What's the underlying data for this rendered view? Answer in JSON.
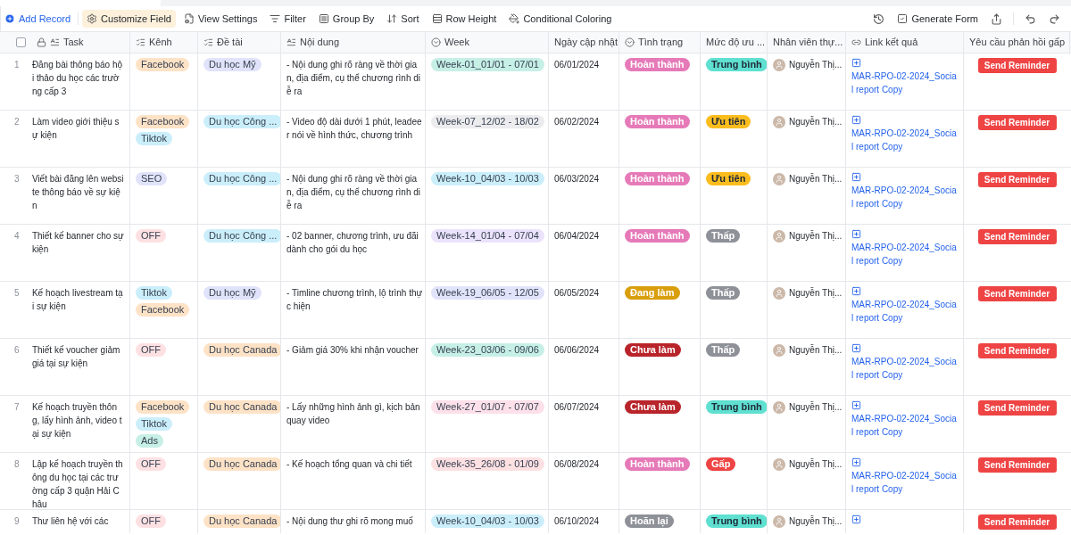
{
  "toolbar": {
    "add_record": "Add Record",
    "tools": [
      {
        "label": "Customize Field",
        "selected": true
      },
      {
        "label": "View Settings",
        "selected": false
      },
      {
        "label": "Filter",
        "selected": false
      },
      {
        "label": "Group By",
        "selected": false
      },
      {
        "label": "Sort",
        "selected": false
      },
      {
        "label": "Row Height",
        "selected": false
      },
      {
        "label": "Conditional Coloring",
        "selected": false
      }
    ],
    "generate_form": "Generate Form"
  },
  "table": {
    "select_all": {
      "checked": false
    },
    "columns": [
      "Task",
      "Kênh",
      "Đề tài",
      "Nội dung",
      "Week",
      "Ngày cập nhật",
      "Tình trạng",
      "Mức độ ưu ...",
      "Nhân viên thự...",
      "Link kết quả",
      "Yêu cầu phản hồi gấp"
    ],
    "rows": [
      {
        "number": "1",
        "task": "Đăng bài thông báo hội thảo du học các trường cấp 3",
        "channels": [
          {
            "label": "Facebook",
            "color": "#fde2c6"
          }
        ],
        "topics": [
          {
            "label": "Du học Mỹ",
            "color": "#e1e3fa"
          }
        ],
        "notes": "- Nội dung ghi rõ ràng về thời gian, địa điểm, cụ thể chương rình diễ ra",
        "week": {
          "label": "Week-01_01/01 - 07/01",
          "color": "#c6efe6"
        },
        "updated": "06/01/2024",
        "status": {
          "label": "Hoàn thành",
          "color": "#e67ab8"
        },
        "priority": {
          "label": "Trung bình",
          "color": "#5fe0d1"
        },
        "assignee": "Nguyễn Thị...",
        "link": "MAR-RPO-02-2024_Social report Copy",
        "action": "Send Reminder"
      },
      {
        "number": "2",
        "task": "Làm video giới thiệu sự kiện",
        "channels": [
          {
            "label": "Facebook",
            "color": "#fde2c6"
          },
          {
            "label": "Tiktok",
            "color": "#cbeefb"
          }
        ],
        "topics": [
          {
            "label": "Du học Công ...",
            "color": "#cbeefb"
          }
        ],
        "notes": "- Video độ dài dưới 1 phút, leadeer nói về hình thức, chương trình",
        "week": {
          "label": "Week-07_12/02 - 18/02",
          "color": "#ececee"
        },
        "updated": "06/02/2024",
        "status": {
          "label": "Hoàn thành",
          "color": "#e67ab8"
        },
        "priority": {
          "label": "Ưu tiên",
          "color": "#fbbd1e"
        },
        "assignee": "Nguyễn Thị...",
        "link": "MAR-RPO-02-2024_Social report Copy",
        "action": "Send Reminder"
      },
      {
        "number": "3",
        "task": "Viết bài đăng lên website thông báo về sự kiện",
        "channels": [
          {
            "label": "SEO",
            "color": "#e1e3fa"
          }
        ],
        "topics": [
          {
            "label": "Du học Công ...",
            "color": "#cbeefb"
          }
        ],
        "notes": "- Nội dung ghi rõ ràng về thời gian, địa điểm, cụ thể chương rình diễ ra",
        "week": {
          "label": "Week-10_04/03 - 10/03",
          "color": "#cbeefb"
        },
        "updated": "06/03/2024",
        "status": {
          "label": "Hoàn thành",
          "color": "#e67ab8"
        },
        "priority": {
          "label": "Ưu tiên",
          "color": "#fbbd1e"
        },
        "assignee": "Nguyễn Thị...",
        "link": "MAR-RPO-02-2024_Social report Copy",
        "action": "Send Reminder"
      },
      {
        "number": "4",
        "task": "Thiết kế banner cho sự kiện",
        "channels": [
          {
            "label": "OFF",
            "color": "#fde0e2"
          }
        ],
        "topics": [
          {
            "label": "Du học Công ...",
            "color": "#cbeefb"
          }
        ],
        "notes": "- 02 banner, chương trình, ưu đãi dành cho gói du học",
        "week": {
          "label": "Week-14_01/04 - 07/04",
          "color": "#ebe3fb"
        },
        "updated": "06/04/2024",
        "status": {
          "label": "Hoàn thành",
          "color": "#e67ab8"
        },
        "priority": {
          "label": "Thấp",
          "color": "#8f9199"
        },
        "assignee": "Nguyễn Thị...",
        "link": "MAR-RPO-02-2024_Social report Copy",
        "action": "Send Reminder"
      },
      {
        "number": "5",
        "task": "Kế hoạch livestream tại sự kiện",
        "channels": [
          {
            "label": "Tiktok",
            "color": "#cbeefb"
          },
          {
            "label": "Facebook",
            "color": "#fde2c6"
          }
        ],
        "topics": [
          {
            "label": "Du học Mỹ",
            "color": "#e1e3fa"
          }
        ],
        "notes": "- Timline chương trình, lộ trình thực hiện",
        "week": {
          "label": "Week-19_06/05 - 12/05",
          "color": "#e1e3fa"
        },
        "updated": "06/05/2024",
        "status": {
          "label": "Đang làm",
          "color": "#d99e0c"
        },
        "priority": {
          "label": "Thấp",
          "color": "#8f9199"
        },
        "assignee": "Nguyễn Thị...",
        "link": "MAR-RPO-02-2024_Social report Copy",
        "action": "Send Reminder"
      },
      {
        "number": "6",
        "task": "Thiết kế voucher giảm giá tại sự kiện",
        "channels": [
          {
            "label": "OFF",
            "color": "#fde0e2"
          }
        ],
        "topics": [
          {
            "label": "Du học Canada",
            "color": "#fde2c6"
          }
        ],
        "notes": "- Giảm giá 30% khi nhận voucher",
        "week": {
          "label": "Week-23_03/06 - 09/06",
          "color": "#c6efe6"
        },
        "updated": "06/06/2024",
        "status": {
          "label": "Chưa làm",
          "color": "#b8242a"
        },
        "priority": {
          "label": "Thấp",
          "color": "#8f9199"
        },
        "assignee": "Nguyễn Thị...",
        "link": "MAR-RPO-02-2024_Social report Copy",
        "action": "Send Reminder"
      },
      {
        "number": "7",
        "task": "Kế hoạch truyền thông, lấy hình ảnh, video tại sự kiện",
        "channels": [
          {
            "label": "Facebook",
            "color": "#fde2c6"
          },
          {
            "label": "Tiktok",
            "color": "#cbeefb"
          },
          {
            "label": "Ads",
            "color": "#c6efe6"
          }
        ],
        "topics": [
          {
            "label": "Du học Canada",
            "color": "#fde2c6"
          }
        ],
        "notes": "- Lấy những hình ảnh gì, kịch bản quay video",
        "week": {
          "label": "Week-27_01/07 - 07/07",
          "color": "#fde0e9"
        },
        "updated": "06/07/2024",
        "status": {
          "label": "Chưa làm",
          "color": "#b8242a"
        },
        "priority": {
          "label": "Trung bình",
          "color": "#5fe0d1"
        },
        "assignee": "Nguyễn Thị...",
        "link": "MAR-RPO-02-2024_Social report Copy",
        "action": "Send Reminder"
      },
      {
        "number": "8",
        "task": "Lập kế hoạch truyền thông du học tại các trường cấp 3 quận Hải Châu",
        "channels": [
          {
            "label": "OFF",
            "color": "#fde0e2"
          }
        ],
        "topics": [
          {
            "label": "Du học Canada",
            "color": "#fde2c6"
          }
        ],
        "notes": "- Kế hoạch tổng quan và chi tiết",
        "week": {
          "label": "Week-35_26/08 - 01/09",
          "color": "#fde0e2"
        },
        "updated": "06/08/2024",
        "status": {
          "label": "Hoàn thành",
          "color": "#e67ab8"
        },
        "priority": {
          "label": "Gấp",
          "color": "#ef4444"
        },
        "assignee": "Nguyễn Thị...",
        "link": "MAR-RPO-02-2024_Social report Copy",
        "action": "Send Reminder"
      },
      {
        "number": "9",
        "task": "Thư liên hệ với các",
        "channels": [
          {
            "label": "OFF",
            "color": "#fde0e2"
          }
        ],
        "topics": [
          {
            "label": "Du học Canada",
            "color": "#fde2c6"
          }
        ],
        "notes": "- Nội dung thư ghi rõ mong muố",
        "week": {
          "label": "Week-10_04/03 - 10/03",
          "color": "#cbeefb"
        },
        "updated": "06/10/2024",
        "status": {
          "label": "Hoãn lại",
          "color": "#8f9199"
        },
        "priority": {
          "label": "Trung bình",
          "color": "#5fe0d1"
        },
        "assignee": "Nguyễn Thị...",
        "action": "Send Reminder"
      }
    ]
  }
}
